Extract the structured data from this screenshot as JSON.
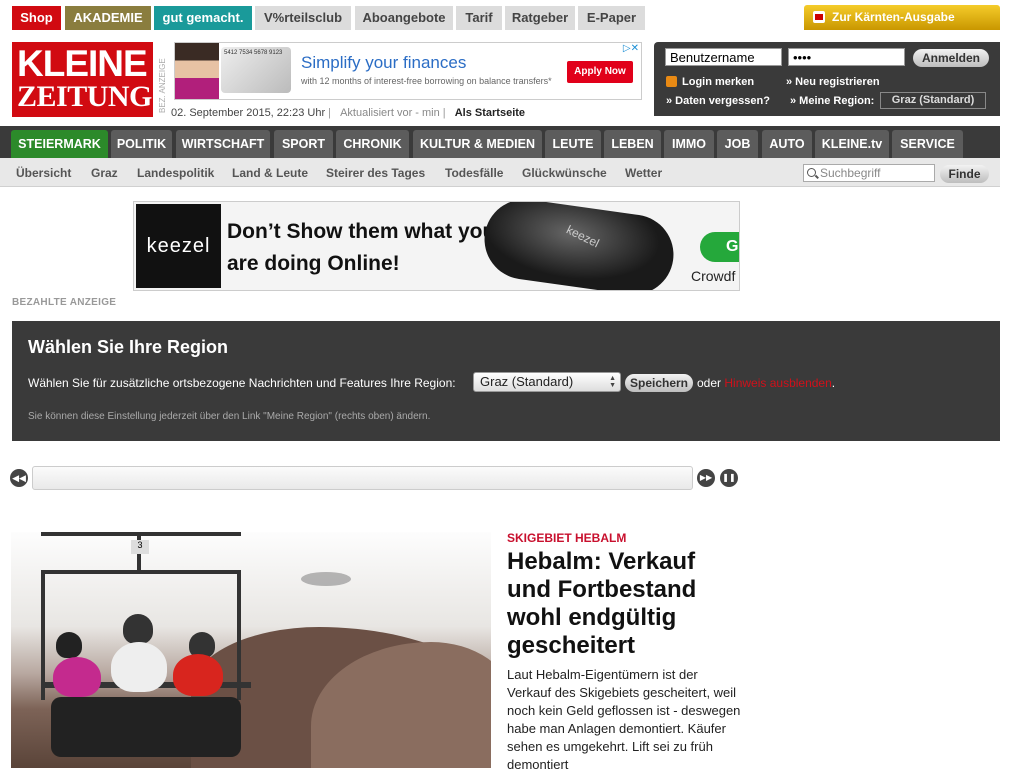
{
  "topbar": {
    "tabs": [
      {
        "label": "Shop",
        "bg": "#d10a11",
        "color": "#ffffff"
      },
      {
        "label": "AKADEMIE",
        "bg": "#8a7d3e",
        "color": "#ffffff"
      },
      {
        "label": "gut gemacht.",
        "bg": "#1a9a9a",
        "color": "#ffffff"
      },
      {
        "label": "V%rteilsclub",
        "bg": "#dcdcdc",
        "color": "#444444"
      },
      {
        "label": "Aboangebote",
        "bg": "#dcdcdc",
        "color": "#444444"
      },
      {
        "label": "Tarif",
        "bg": "#dcdcdc",
        "color": "#444444"
      },
      {
        "label": "Ratgeber",
        "bg": "#dcdcdc",
        "color": "#444444"
      },
      {
        "label": "E-Paper",
        "bg": "#dcdcdc",
        "color": "#444444"
      }
    ],
    "regional_button": "Zur Kärnten-Ausgabe"
  },
  "header": {
    "logo_line1": "KLEINE",
    "logo_line2": "ZEITUNG",
    "ad_label": "BEZ. ANZEIGE",
    "date": "02. September 2015, 22:23 Uhr",
    "updated": "Aktualisiert vor - min",
    "set_homepage": "Als Startseite"
  },
  "fin_ad": {
    "headline": "Simplify your finances",
    "subline": "with 12 months of interest-free borrowing on balance transfers*",
    "cta": "Apply Now",
    "card_text": "5412 7534 5678 9123"
  },
  "login": {
    "username_value": "Benutzername",
    "password_value": "••••",
    "submit": "Anmelden",
    "remember": "Login merken",
    "register": "» Neu registrieren",
    "forgot": "» Daten vergessen?",
    "my_region": "» Meine Region:",
    "region_value": "Graz (Standard)"
  },
  "mainnav": [
    "STEIERMARK",
    "POLITIK",
    "WIRTSCHAFT",
    "SPORT",
    "CHRONIK",
    "KULTUR & MEDIEN",
    "LEUTE",
    "LEBEN",
    "IMMO",
    "JOB",
    "AUTO",
    "KLEINE.tv",
    "SERVICE"
  ],
  "subnav": [
    "Übersicht",
    "Graz",
    "Landespolitik",
    "Land & Leute",
    "Steirer des Tages",
    "Todesfälle",
    "Glückwünsche",
    "Wetter"
  ],
  "search": {
    "placeholder": "Suchbegriff",
    "button": "Finde"
  },
  "keezel_ad": {
    "brand": "keezel",
    "line1": "Don’t Show them what you",
    "line2": "are doing Online!",
    "device_brand": "keezel",
    "cta": "GE",
    "crowd": "Crowdf"
  },
  "paid_ad_label": "BEZAHLTE ANZEIGE",
  "region_box": {
    "title": "Wählen Sie Ihre Region",
    "question": "Wählen Sie für zusätzliche ortsbezogene Nachrichten und Features Ihre Region:",
    "selected": "Graz (Standard)",
    "save": "Speichern",
    "or": "oder",
    "hide_hint": "Hinweis ausblenden",
    "period": ".",
    "note": "Sie können diese Einstellung jederzeit über den Link \"Meine Region\" (rechts oben) ändern."
  },
  "slider": {
    "prev": "◀◀",
    "next": "▶▶",
    "pause": "❚❚"
  },
  "article": {
    "kicker": "SKIGEBIET HEBALM",
    "headline": "Hebalm: Verkauf und Fortbestand wohl endgültig gescheitert",
    "teaser": "Laut Hebalm-Eigentümern ist der Verkauf des Skigebiets gescheitert, weil noch kein Geld geflossen ist - deswegen habe man Anlagen demontiert. Käufer sehen es umgekehrt. Lift sei zu früh demontiert",
    "chair_number": "3"
  }
}
